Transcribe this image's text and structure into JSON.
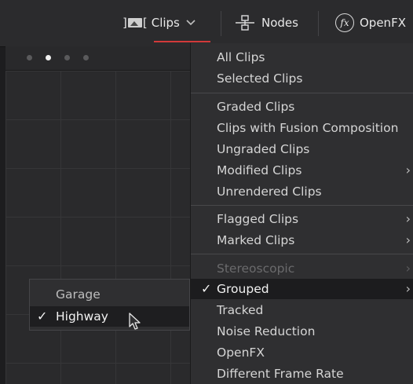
{
  "toolbar": {
    "clips_label": "Clips",
    "clips_chevron": "chevron-down",
    "nodes_label": "Nodes",
    "openfx_label": "OpenFX",
    "openfx_glyph": "fx",
    "active_underline_color": "#d23a3a"
  },
  "viewer": {
    "page_dots": 4,
    "active_dot": 2
  },
  "menu": {
    "items": [
      {
        "label": "All Clips"
      },
      {
        "label": "Selected Clips"
      },
      {
        "label": "Graded Clips"
      },
      {
        "label": "Clips with Fusion Composition"
      },
      {
        "label": "Ungraded Clips"
      },
      {
        "label": "Modified Clips",
        "submenu": true
      },
      {
        "label": "Unrendered Clips"
      },
      {
        "label": "Flagged Clips",
        "submenu": true
      },
      {
        "label": "Marked Clips",
        "submenu": true
      },
      {
        "label": "Stereoscopic",
        "submenu": true,
        "disabled": true
      },
      {
        "label": "Grouped",
        "submenu": true,
        "checked": true,
        "highlighted": true
      },
      {
        "label": "Tracked"
      },
      {
        "label": "Noise Reduction"
      },
      {
        "label": "OpenFX"
      },
      {
        "label": "Different Frame Rate"
      }
    ],
    "check_glyph": "✓",
    "submenu_glyph": "›"
  },
  "grouped_submenu": {
    "items": [
      {
        "label": "Garage"
      },
      {
        "label": "Highway",
        "checked": true,
        "highlighted": true
      }
    ]
  }
}
